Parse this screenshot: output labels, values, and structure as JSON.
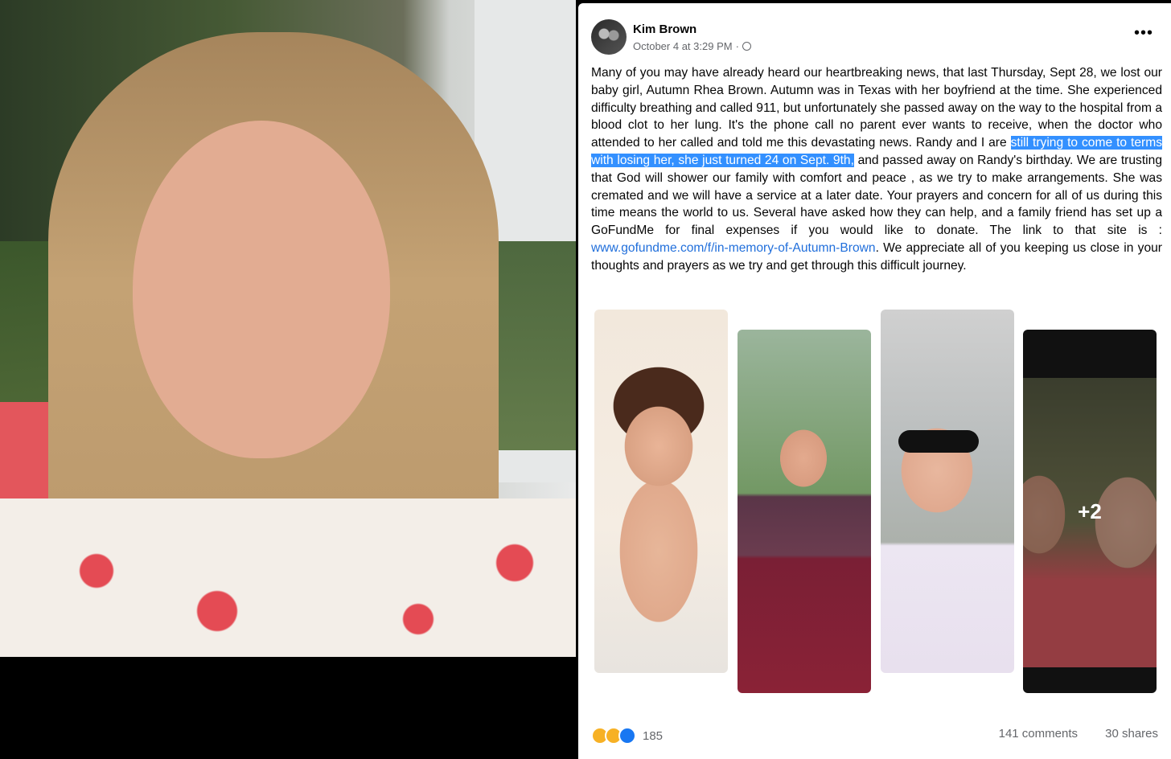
{
  "post": {
    "author": "Kim Brown",
    "timestamp": "October 4 at 3:29 PM",
    "separator": "·",
    "more_label": "•••",
    "body": {
      "part1": "Many of you may have already heard our heartbreaking news, that last Thursday, Sept 28, we lost our baby girl, Autumn Rhea Brown. Autumn was in Texas with her boyfriend at the time. She experienced difficulty breathing and called 911, but unfortunately she passed away on the way to the hospital from a blood clot to her lung. It's the phone call no parent ever wants to receive, when the doctor who attended to her called and told me this devastating news. Randy and I are ",
      "highlight": "still trying to come to terms with losing her, she just turned 24 on Sept. 9th,",
      "part2": " and passed away on Randy's birthday. We are trusting that God will shower our family with comfort and peace , as we try to make arrangements.  She was cremated and we will have a service at a later date.  Your prayers and concern for all of us during this time means the world to us.  Several have asked how they can help, and a family friend has set up a GoFundMe for final expenses if you would like to donate. The link to that site is : ",
      "link": "www.gofundme.com/f/in-memory-of-Autumn-Brown",
      "part3": ". We appreciate all of you keeping us close in your thoughts and prayers as we try and get through this difficult journey."
    },
    "more_photos": "+2",
    "reaction_count": "185",
    "comments": "141 comments",
    "shares": "30 shares"
  }
}
